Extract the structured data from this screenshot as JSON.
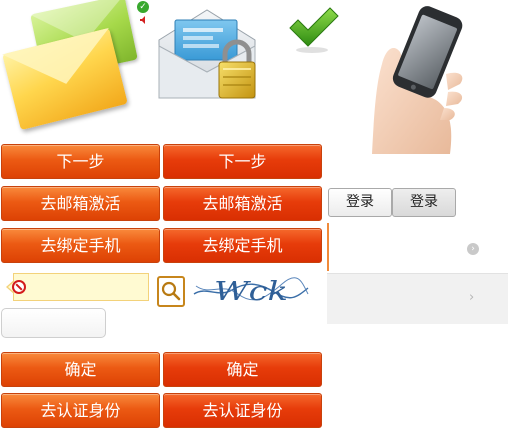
{
  "buttons": {
    "next": "下一步",
    "activate_email": "去邮箱激活",
    "bind_phone": "去绑定手机",
    "confirm": "确定",
    "verify_identity": "去认证身份",
    "login": "登录"
  },
  "captcha": {
    "text": "Wck"
  },
  "colors": {
    "orange_button": "#ec5a13",
    "red_button": "#e73c0a",
    "error_field_bg": "#fffad2",
    "success_green": "#39a82e"
  },
  "icons": {
    "envelopes": "envelopes-icon",
    "locked_mail": "locked-mail-icon",
    "checkmark": "checkmark-icon",
    "phone_hand": "phone-in-hand-icon",
    "small_check": "small-check-icon",
    "speaker": "speaker-icon",
    "error": "error-icon",
    "search": "search-icon",
    "arrow_circle": "chevron-circle-right-icon",
    "arrow": "chevron-right-icon"
  }
}
